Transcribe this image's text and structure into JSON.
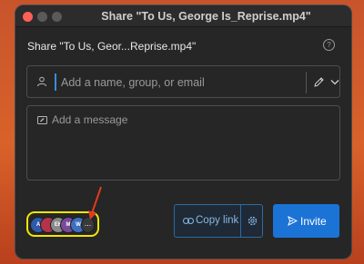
{
  "window": {
    "title": "Share \"To Us, George Is_Reprise.mp4\""
  },
  "dialog": {
    "header": "Share \"To Us, Geor...Reprise.mp4\"",
    "help_icon": "help-circle-icon",
    "help_glyph": "?"
  },
  "recipient": {
    "placeholder": "Add a name, group, or email",
    "value": "",
    "person_icon": "person-icon",
    "edit_icon": "pencil-icon",
    "dropdown_icon": "chevron-down-icon"
  },
  "message": {
    "placeholder": "Add a message",
    "value": "",
    "icon": "message-icon"
  },
  "access": {
    "avatars": [
      {
        "initials": "A",
        "color": "#2f5aa8"
      },
      {
        "initials": "",
        "color": "#b5334a"
      },
      {
        "initials": "EK",
        "color": "#8a8a8a"
      },
      {
        "initials": "M",
        "color": "#7a4a9a"
      },
      {
        "initials": "W",
        "color": "#3e6fc0"
      }
    ],
    "more_label": "...",
    "highlight_color": "#f2e600",
    "annotation_color": "#e23b22"
  },
  "actions": {
    "copy_link_label": "Copy link",
    "copy_link_icon": "link-icon",
    "settings_icon": "gear-icon",
    "invite_label": "Invite",
    "invite_icon": "send-icon",
    "accent_color": "#1b73d6"
  }
}
